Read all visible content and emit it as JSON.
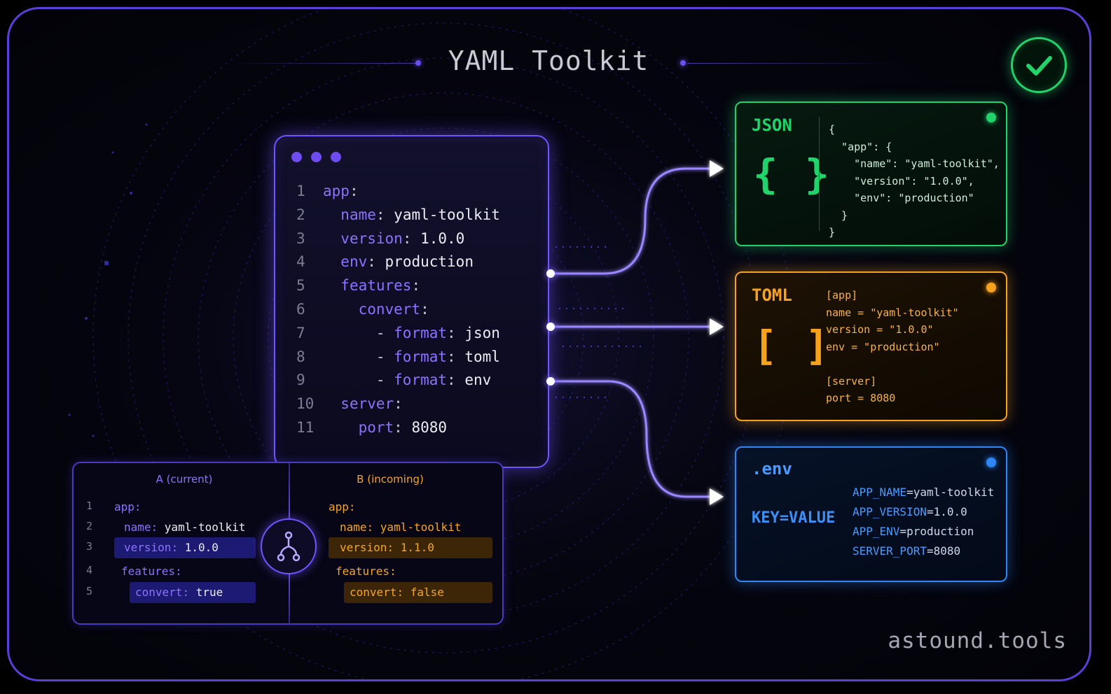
{
  "title": "YAML Toolkit",
  "footer": "astound.tools",
  "colors": {
    "accent": "#6d55ff",
    "json": "#22d36b",
    "toml": "#f7a21d",
    "env": "#2f86f6",
    "merge_current": "#8d72ff",
    "merge_incoming": "#f5a623"
  },
  "editor": {
    "lines": [
      {
        "n": "1",
        "indent": "",
        "dash": "",
        "key": "app",
        "sep": ":",
        "value": ""
      },
      {
        "n": "2",
        "indent": "  ",
        "dash": "",
        "key": "name",
        "sep": ": ",
        "value": "yaml-toolkit"
      },
      {
        "n": "3",
        "indent": "  ",
        "dash": "",
        "key": "version",
        "sep": ": ",
        "value": "1.0.0"
      },
      {
        "n": "4",
        "indent": "  ",
        "dash": "",
        "key": "env",
        "sep": ": ",
        "value": "production"
      },
      {
        "n": "5",
        "indent": "  ",
        "dash": "",
        "key": "features",
        "sep": ":",
        "value": ""
      },
      {
        "n": "6",
        "indent": "    ",
        "dash": "",
        "key": "convert",
        "sep": ":",
        "value": ""
      },
      {
        "n": "7",
        "indent": "      ",
        "dash": "- ",
        "key": "format",
        "sep": ": ",
        "value": "json"
      },
      {
        "n": "8",
        "indent": "      ",
        "dash": "- ",
        "key": "format",
        "sep": ": ",
        "value": "toml"
      },
      {
        "n": "9",
        "indent": "      ",
        "dash": "- ",
        "key": "format",
        "sep": ": ",
        "value": "env"
      },
      {
        "n": "10",
        "indent": "  ",
        "dash": "",
        "key": "server",
        "sep": ":",
        "value": ""
      },
      {
        "n": "11",
        "indent": "    ",
        "dash": "",
        "key": "port",
        "sep": ": ",
        "value": "8080"
      }
    ]
  },
  "outputs": {
    "json": {
      "label": "JSON",
      "icon": "{ }",
      "lines": [
        "{",
        "  \"app\": {",
        "    \"name\": \"yaml-toolkit\",",
        "    \"version\": \"1.0.0\",",
        "    \"env\": \"production\"",
        "  }",
        "}"
      ]
    },
    "toml": {
      "label": "TOML",
      "icon": "[ ]",
      "lines": [
        "[app]",
        "name = \"yaml-toolkit\"",
        "version = \"1.0.0\"",
        "env = \"production\"",
        "",
        "[server]",
        "port = 8080"
      ]
    },
    "env": {
      "label": ".env",
      "icon": "KEY=VALUE",
      "lines": [
        {
          "key": "APP_NAME",
          "value": "=yaml-toolkit"
        },
        {
          "key": "APP_VERSION",
          "value": "=1.0.0"
        },
        {
          "key": "APP_ENV",
          "value": "=production"
        },
        {
          "key": "SERVER_PORT",
          "value": "=8080"
        }
      ]
    }
  },
  "merge": {
    "a_label": "A (current)",
    "b_label": "B (incoming)",
    "line_numbers": [
      "1",
      "2",
      "3",
      "4",
      "5"
    ],
    "a": [
      {
        "key": "app",
        "sep": ":",
        "value": ""
      },
      {
        "key": "name",
        "sep": ": ",
        "value": "yaml-toolkit"
      },
      {
        "key": "version",
        "sep": ": ",
        "value": "1.0.0"
      },
      {
        "key": "features",
        "sep": ":",
        "value": ""
      },
      {
        "key": "convert",
        "sep": ": ",
        "value": "true"
      }
    ],
    "b": [
      {
        "key": "app",
        "sep": ":",
        "value": ""
      },
      {
        "key": "name",
        "sep": ": ",
        "value": "yaml-toolkit"
      },
      {
        "key": "version",
        "sep": ": ",
        "value": "1.1.0"
      },
      {
        "key": "features",
        "sep": ":",
        "value": ""
      },
      {
        "key": "convert",
        "sep": ": ",
        "value": "false"
      }
    ]
  }
}
